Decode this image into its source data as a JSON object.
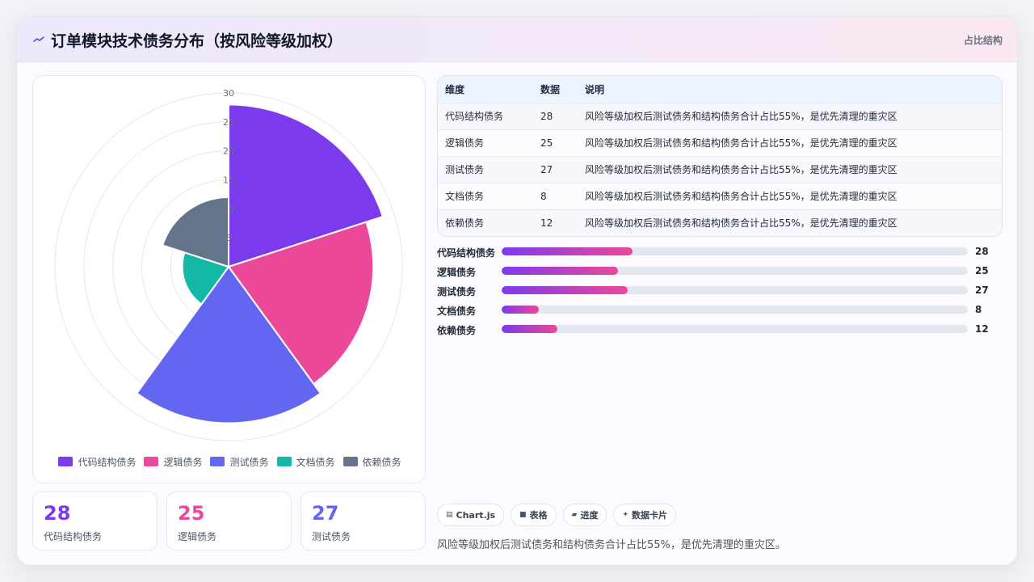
{
  "header": {
    "title": "订单模块技术债务分布（按风险等级加权）",
    "tag": "占比结构"
  },
  "colors": {
    "accent": "#7c3aed",
    "pink": "#ec4899",
    "series": [
      "#7c3aed",
      "#ec4899",
      "#6366f1",
      "#14b8a6",
      "#64748b"
    ]
  },
  "chart_data": {
    "type": "polarArea",
    "categories": [
      "代码结构债务",
      "逻辑债务",
      "测试债务",
      "文档债务",
      "依赖债务"
    ],
    "values": [
      28,
      25,
      27,
      8,
      12
    ],
    "rlim": [
      0,
      30
    ],
    "ticks": [
      "5",
      "10",
      "15",
      "20",
      "25",
      "30"
    ],
    "legend_position": "bottom",
    "grid": true
  },
  "table": {
    "headers": [
      "维度",
      "数据",
      "说明"
    ],
    "rows": [
      [
        "代码结构债务",
        "28",
        "风险等级加权后测试债务和结构债务合计占比55%，是优先清理的重灾区"
      ],
      [
        "逻辑债务",
        "25",
        "风险等级加权后测试债务和结构债务合计占比55%，是优先清理的重灾区"
      ],
      [
        "测试债务",
        "27",
        "风险等级加权后测试债务和结构债务合计占比55%，是优先清理的重灾区"
      ],
      [
        "文档债务",
        "8",
        "风险等级加权后测试债务和结构债务合计占比55%，是优先清理的重灾区"
      ],
      [
        "依赖债务",
        "12",
        "风险等级加权后测试债务和结构债务合计占比55%，是优先清理的重灾区"
      ]
    ]
  },
  "progress": {
    "max": 100,
    "items": [
      {
        "label": "代码结构债务",
        "value": 28,
        "display": "28"
      },
      {
        "label": "逻辑债务",
        "value": 25,
        "display": "25"
      },
      {
        "label": "测试债务",
        "value": 27,
        "display": "27"
      },
      {
        "label": "文档债务",
        "value": 8,
        "display": "8"
      },
      {
        "label": "依赖债务",
        "value": 12,
        "display": "12"
      }
    ]
  },
  "kpis": [
    {
      "value": "28",
      "label": "代码结构债务",
      "color": "#7c3aed"
    },
    {
      "value": "25",
      "label": "逻辑债务",
      "color": "#ec4899"
    },
    {
      "value": "27",
      "label": "测试债务",
      "color": "#6366f1"
    }
  ],
  "chips": [
    {
      "icon": "chart-icon",
      "label": "Chart.js"
    },
    {
      "icon": "table-icon",
      "label": "表格"
    },
    {
      "icon": "progress-icon",
      "label": "进度"
    },
    {
      "icon": "sparkle-icon",
      "label": "数据卡片"
    }
  ],
  "note": "风险等级加权后测试债务和结构债务合计占比55%，是优先清理的重灾区。"
}
